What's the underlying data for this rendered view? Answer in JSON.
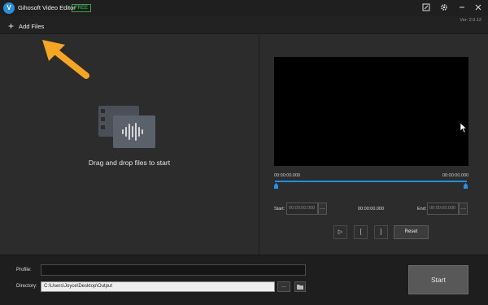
{
  "titlebar": {
    "logo": "V",
    "title": "Gihosoft Video Editor",
    "badge": "FREE",
    "icons": [
      "register-icon",
      "gear-icon",
      "minimize-icon",
      "close-icon"
    ]
  },
  "toolbar": {
    "add_files_label": "Add Files",
    "version": "Ver: 2.0.12"
  },
  "drop_area": {
    "text": "Drag and drop files to start"
  },
  "player": {
    "time_start": "00:00:00.000",
    "time_end": "00:00:00.000",
    "start_label": "Start:",
    "start_value": "00:00:00.000",
    "mid_time": "00:00:00.000",
    "end_label": "End:",
    "end_value": "00:00:00.000",
    "play_symbol": "▷",
    "mark_in_symbol": "[",
    "mark_out_symbol": "]",
    "reset_label": "Reset"
  },
  "output": {
    "profile_label": "Profile:",
    "profile_value": "",
    "directory_label": "Directory:",
    "directory_value": "C:\\Users\\Joyce\\Desktop\\Output",
    "browse_label": "...",
    "start_label": "Start"
  },
  "colors": {
    "accent": "#2a8fe8",
    "annotation_arrow": "#f5a623",
    "free_badge": "#3fbf55"
  }
}
